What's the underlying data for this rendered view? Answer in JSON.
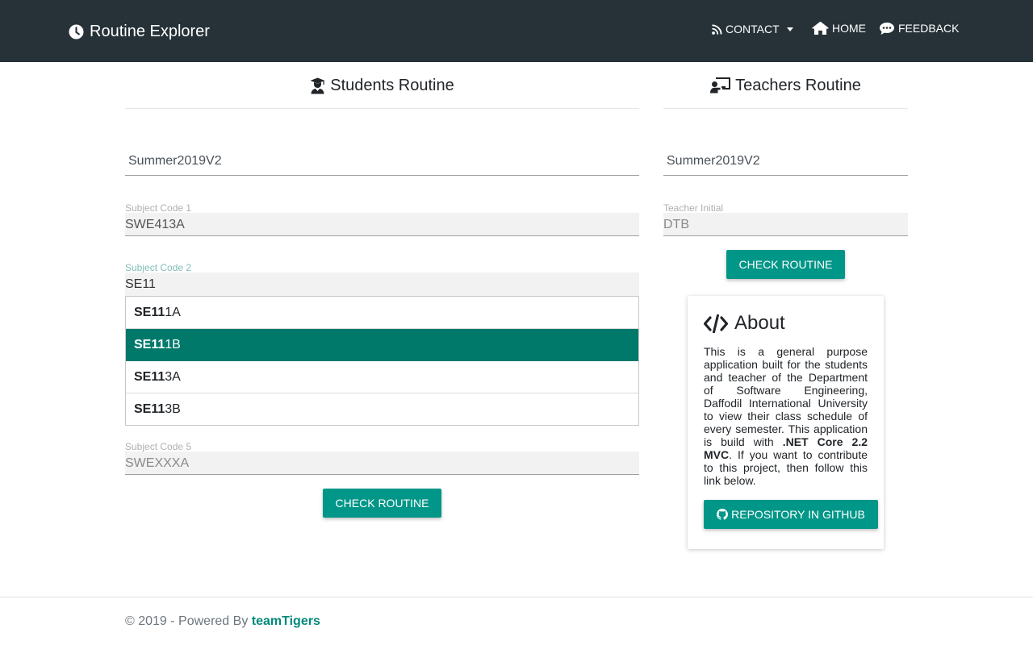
{
  "navbar": {
    "brand": "Routine Explorer",
    "brand_icon": "clock-icon",
    "items": [
      {
        "label": "CONTACT",
        "icon": "rss-icon",
        "dropdown": true
      },
      {
        "label": "HOME",
        "icon": "home-icon"
      },
      {
        "label": "FEEDBACK",
        "icon": "comment-dots-icon"
      }
    ]
  },
  "students": {
    "title": "Students Routine",
    "icon": "user-graduate-icon",
    "semester": "Summer2019V2",
    "subject1": {
      "label": "Subject Code 1",
      "value": "SWE413A"
    },
    "subject2": {
      "label": "Subject Code 2",
      "value": "SE11"
    },
    "suggestions": [
      {
        "match": "SE11",
        "rest": "1A"
      },
      {
        "match": "SE11",
        "rest": "1B",
        "selected": true
      },
      {
        "match": "SE11",
        "rest": "3A"
      },
      {
        "match": "SE11",
        "rest": "3B"
      }
    ],
    "subject5": {
      "label": "Subject Code 5",
      "placeholder": "SWEXXXA"
    },
    "button": "CHECK ROUTINE"
  },
  "teachers": {
    "title": "Teachers Routine",
    "icon": "chalkboard-teacher-icon",
    "semester": "Summer2019V2",
    "initial": {
      "label": "Teacher Initial",
      "placeholder": "DTB"
    },
    "button": "CHECK ROUTINE"
  },
  "about": {
    "title": "About",
    "icon": "code-icon",
    "text_pre": "This is a general purpose application built for the students and teacher of the Department of Software Engineering, Daffodil International University to view their class schedule of every semester. This application is build with ",
    "text_bold": ".NET Core 2.2 MVC",
    "text_post": ". If you want to contribute to this project, then follow this link below.",
    "button": "REPOSITORY IN GITHUB",
    "button_icon": "github-icon"
  },
  "footer": {
    "text": "© 2019 - Powered By ",
    "brand": "teamTigers"
  },
  "colors": {
    "navbar": "#263238",
    "primary": "#009688",
    "selected": "#00796b"
  }
}
